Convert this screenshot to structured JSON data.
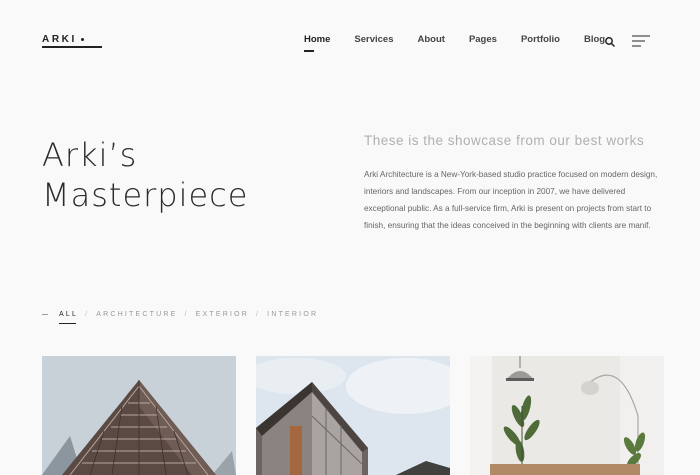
{
  "header": {
    "logo": "ARKI",
    "nav": [
      "Home",
      "Services",
      "About",
      "Pages",
      "Portfolio",
      "Blog"
    ],
    "active_nav": "Home"
  },
  "hero": {
    "title_line1": "Arki’s",
    "title_line2": "Masterpiece",
    "subtitle": "These is the showcase from our best works",
    "description": "Arki Architecture is a New-York-based studio practice focused on modern design, interiors and landscapes. From our inception in 2007, we have delivered exceptional public. As a full-service firm, Arki is present on projects from start to finish, ensuring that the ideas conceived in the beginning with clients are manif."
  },
  "filters": {
    "items": [
      "ALL",
      "ARCHITECTURE",
      "EXTERIOR",
      "INTERIOR"
    ],
    "active": "ALL",
    "separator": "/"
  },
  "gallery": {
    "items": [
      {
        "subject": "tall building facade"
      },
      {
        "subject": "modern building corner against sky"
      },
      {
        "subject": "interior with plants and floor lamp"
      }
    ]
  },
  "icons": {
    "search": "search-icon",
    "menu": "menu-icon"
  },
  "colors": {
    "background": "#f9f9f9",
    "text": "#222222",
    "muted": "#b0b0b0"
  }
}
